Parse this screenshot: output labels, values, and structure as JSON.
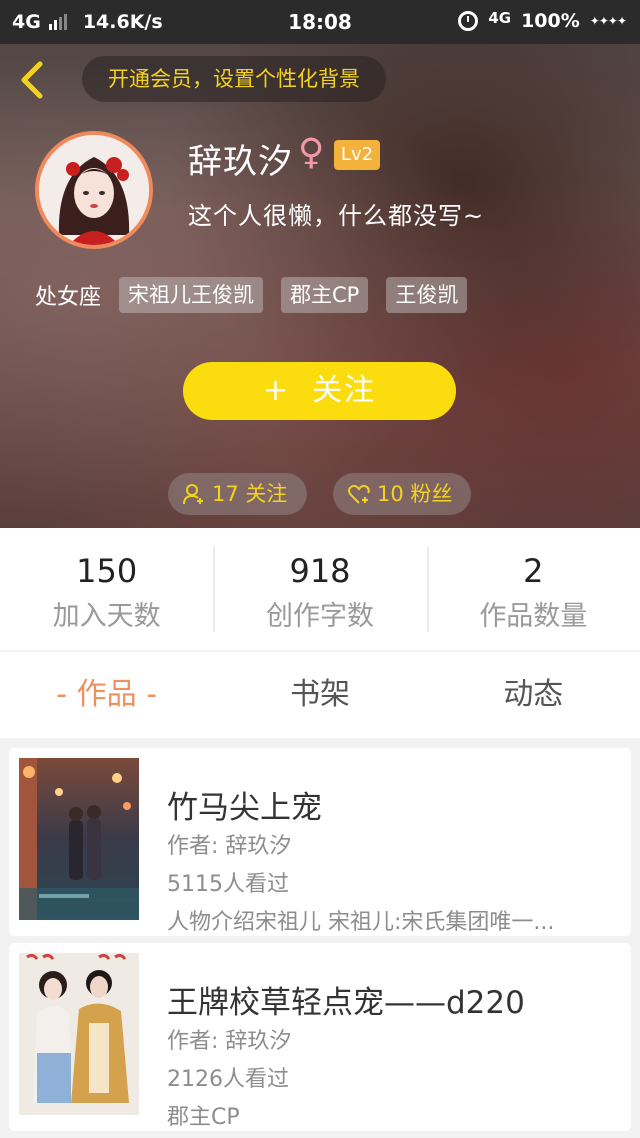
{
  "status_bar": {
    "network": "4G",
    "speed": "14.6K/s",
    "time": "18:08",
    "network_right": "4G",
    "battery": "100%",
    "stars": "✦✦✦✦"
  },
  "header": {
    "back_icon": "chevron-left-icon",
    "vip_banner": "开通会员，设置个性化背景"
  },
  "profile": {
    "username": "辞玖汐",
    "gender_symbol": "♀",
    "level": "Lv2",
    "bio": "这个人很懒，什么都没写~",
    "zodiac": "处女座",
    "tags": [
      "宋祖儿王俊凯",
      "郡主CP",
      "王俊凯"
    ],
    "follow_button": {
      "plus": "+",
      "label": "关注"
    },
    "following": "17 关注",
    "fans": "10 粉丝"
  },
  "stats": [
    {
      "value": "150",
      "label": "加入天数"
    },
    {
      "value": "918",
      "label": "创作字数"
    },
    {
      "value": "2",
      "label": "作品数量"
    }
  ],
  "tabs": [
    {
      "label": "- 作品 -",
      "active": true
    },
    {
      "label": "书架",
      "active": false
    },
    {
      "label": "动态",
      "active": false
    }
  ],
  "works": [
    {
      "title": "竹马尖上宠",
      "author": "作者: 辞玖汐",
      "views": "5115人看过",
      "desc": "人物介绍宋祖儿 宋祖儿:宋氏集团唯一..."
    },
    {
      "title": "王牌校草轻点宠——d220",
      "author": "作者: 辞玖汐",
      "views": "2126人看过",
      "desc": "郡主CP"
    }
  ],
  "colors": {
    "accent_yellow": "#fbdd0f",
    "active_tab": "#f1905f",
    "level_badge": "#f3b23b"
  }
}
